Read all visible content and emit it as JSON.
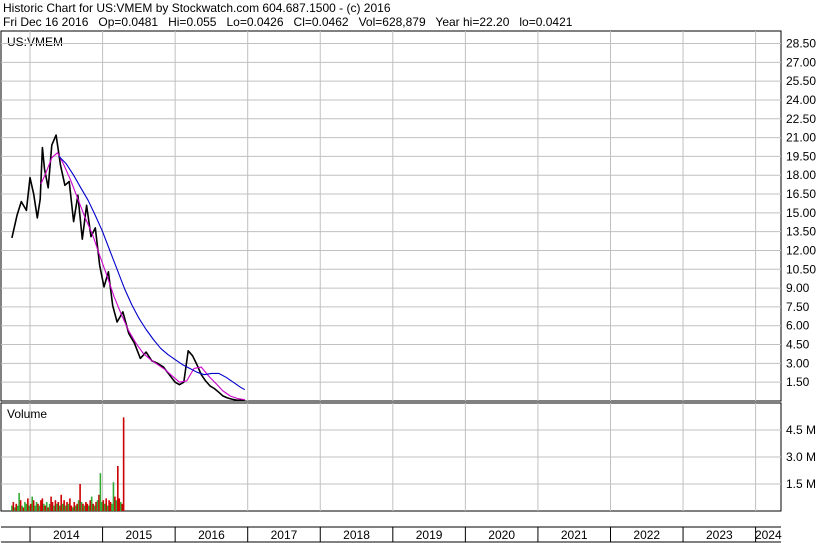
{
  "header": {
    "line1": "Historic Chart for US:VMEM by Stockwatch.com 604.687.1500 - (c) 2016",
    "line2": "Fri Dec 16 2016   Op=0.0481   Hi=0.055   Lo=0.0426   Cl=0.0462   Vol=628,879   Year hi=22.20   lo=0.0421"
  },
  "chart_data": [
    {
      "type": "line",
      "title": "US:VMEM",
      "y_ticks": [
        "28.50",
        "27.00",
        "25.50",
        "24.00",
        "22.50",
        "21.00",
        "19.50",
        "18.00",
        "16.50",
        "15.00",
        "13.50",
        "12.00",
        "10.50",
        "9.00",
        "7.50",
        "6.00",
        "4.50",
        "3.00",
        "1.50"
      ],
      "ylim": [
        0,
        29.5
      ],
      "x_ticks": [
        "2014",
        "2015",
        "2016",
        "2017",
        "2018",
        "2019",
        "2020",
        "2021",
        "2022",
        "2023",
        "2024"
      ],
      "grid": true,
      "colors": {
        "price": "#000000",
        "ma_short": "#cc00cc",
        "ma_long": "#0000cc"
      },
      "series": [
        {
          "role": "price",
          "x": [
            2013.75,
            2013.82,
            2013.88,
            2013.95,
            2014.0,
            2014.05,
            2014.1,
            2014.14,
            2014.17,
            2014.2,
            2014.25,
            2014.3,
            2014.36,
            2014.42,
            2014.48,
            2014.54,
            2014.6,
            2014.66,
            2014.72,
            2014.78,
            2014.84,
            2014.9,
            2014.96,
            2015.02,
            2015.08,
            2015.14,
            2015.2,
            2015.28,
            2015.36,
            2015.44,
            2015.52,
            2015.6,
            2015.68,
            2015.76,
            2015.84,
            2015.92,
            2016.0,
            2016.06,
            2016.12,
            2016.18,
            2016.24,
            2016.3,
            2016.36,
            2016.42,
            2016.48,
            2016.54,
            2016.6,
            2016.66,
            2016.72,
            2016.78,
            2016.84,
            2016.9,
            2016.96
          ],
          "values": [
            13.0,
            14.8,
            15.9,
            15.2,
            17.8,
            16.5,
            14.6,
            16.1,
            20.2,
            18.5,
            17.0,
            20.4,
            21.2,
            18.8,
            17.2,
            17.5,
            14.3,
            16.4,
            12.9,
            15.6,
            13.1,
            13.8,
            10.8,
            9.1,
            10.3,
            7.6,
            6.3,
            7.1,
            5.4,
            4.6,
            3.4,
            3.9,
            3.2,
            3.0,
            2.7,
            2.1,
            1.5,
            1.3,
            1.5,
            4.0,
            3.6,
            2.9,
            2.1,
            1.6,
            1.2,
            1.0,
            0.7,
            0.4,
            0.25,
            0.15,
            0.08,
            0.06,
            0.05
          ]
        },
        {
          "role": "ma_short",
          "x": [
            2014.15,
            2014.22,
            2014.3,
            2014.38,
            2014.46,
            2014.56,
            2014.66,
            2014.76,
            2014.86,
            2014.96,
            2015.06,
            2015.16,
            2015.26,
            2015.36,
            2015.46,
            2015.56,
            2015.66,
            2015.76,
            2015.86,
            2015.96,
            2016.06,
            2016.16,
            2016.26,
            2016.36,
            2016.46,
            2016.56,
            2016.66,
            2016.76,
            2016.86,
            2016.96
          ],
          "values": [
            17.3,
            18.2,
            19.4,
            19.8,
            18.9,
            17.6,
            16.1,
            14.6,
            13.3,
            11.6,
            10.0,
            8.3,
            6.9,
            5.6,
            4.6,
            3.8,
            3.3,
            2.9,
            2.5,
            2.0,
            1.5,
            1.6,
            2.6,
            2.7,
            2.0,
            1.4,
            0.8,
            0.4,
            0.2,
            0.1
          ]
        },
        {
          "role": "ma_long",
          "x": [
            2014.4,
            2014.5,
            2014.6,
            2014.7,
            2014.8,
            2014.9,
            2015.0,
            2015.1,
            2015.2,
            2015.3,
            2015.4,
            2015.5,
            2015.6,
            2015.7,
            2015.8,
            2015.9,
            2016.0,
            2016.1,
            2016.2,
            2016.3,
            2016.4,
            2016.5,
            2016.6,
            2016.7,
            2016.8,
            2016.9,
            2016.96
          ],
          "values": [
            19.5,
            18.9,
            18.0,
            17.0,
            16.0,
            14.8,
            13.5,
            12.0,
            10.5,
            9.0,
            7.7,
            6.6,
            5.7,
            4.9,
            4.2,
            3.7,
            3.3,
            2.9,
            2.6,
            2.3,
            2.1,
            2.2,
            2.2,
            1.9,
            1.5,
            1.1,
            0.9
          ]
        }
      ]
    },
    {
      "type": "bar",
      "title": "Volume",
      "y_ticks": [
        "4.5 M",
        "3.0 M",
        "1.5 M"
      ],
      "ylim": [
        0,
        6.0
      ],
      "colors": {
        "up": "#33aa33",
        "down": "#cc0000"
      },
      "x_start": 2013.75,
      "x_step": 0.02,
      "values": [
        0.3,
        0.5,
        0.2,
        0.4,
        0.3,
        1.0,
        0.6,
        0.3,
        0.2,
        0.5,
        0.4,
        0.7,
        0.3,
        0.4,
        0.8,
        0.6,
        0.3,
        0.5,
        0.4,
        0.3,
        0.6,
        0.7,
        0.4,
        0.3,
        0.5,
        0.2,
        0.4,
        0.8,
        0.5,
        0.3,
        0.6,
        0.4,
        0.5,
        0.3,
        0.9,
        0.4,
        0.6,
        0.3,
        0.5,
        0.4,
        0.7,
        0.3,
        0.2,
        0.5,
        0.3,
        0.4,
        0.6,
        1.5,
        0.5,
        0.4,
        0.3,
        0.5,
        0.4,
        0.3,
        0.6,
        0.8,
        0.4,
        0.3,
        0.5,
        0.6,
        0.9,
        2.1,
        0.5,
        0.6,
        0.4,
        0.7,
        0.3,
        0.6,
        0.5,
        0.4,
        1.6,
        0.8,
        0.6,
        2.5,
        0.7,
        0.5,
        0.4,
        5.2
      ],
      "up": [
        1,
        0,
        1,
        0,
        1,
        1,
        0,
        1,
        0,
        1,
        1,
        0,
        1,
        0,
        1,
        0,
        1,
        1,
        0,
        1,
        0,
        0,
        1,
        0,
        1,
        0,
        1,
        0,
        0,
        1,
        0,
        1,
        0,
        1,
        0,
        1,
        0,
        1,
        0,
        1,
        0,
        0,
        1,
        0,
        1,
        0,
        1,
        0,
        1,
        0,
        1,
        0,
        0,
        1,
        0,
        1,
        0,
        1,
        0,
        1,
        0,
        1,
        1,
        0,
        1,
        0,
        1,
        0,
        0,
        1,
        1,
        0,
        1,
        0,
        0,
        1,
        0,
        0
      ]
    }
  ]
}
